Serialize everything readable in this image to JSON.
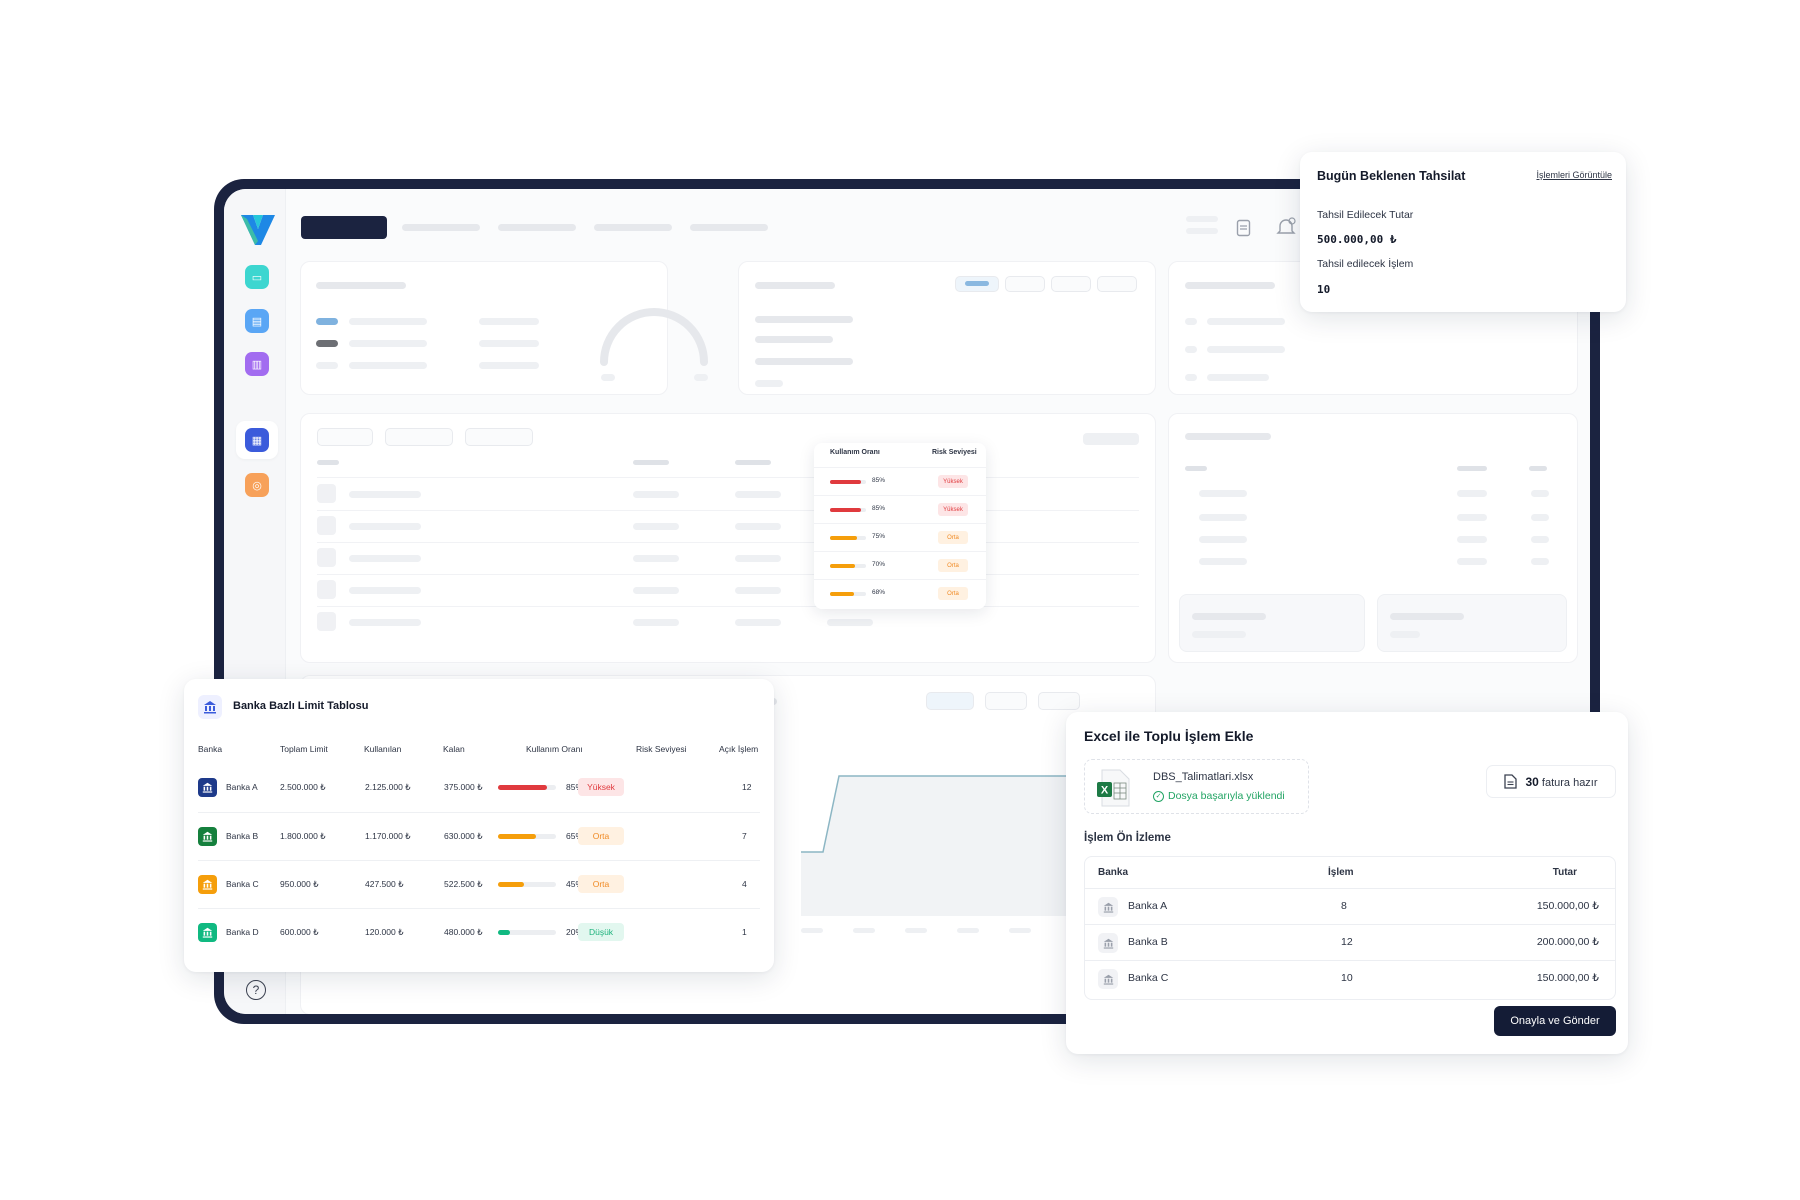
{
  "tahsilat": {
    "title": "Bugün Beklenen Tahsilat",
    "link": "İşlemleri Görüntüle",
    "amount_label": "Tahsil Edilecek Tutar",
    "amount_value": "500.000,00 ₺",
    "count_label": "Tahsil edilecek İşlem",
    "count_value": "10"
  },
  "background_popup": {
    "headers": [
      "Kullanım Oranı",
      "Risk Seviyesi"
    ],
    "rows": [
      {
        "pct": "85%",
        "ratio": 0.85,
        "risk": "Yüksek",
        "level": "high"
      },
      {
        "pct": "85%",
        "ratio": 0.85,
        "risk": "Yüksek",
        "level": "high"
      },
      {
        "pct": "75%",
        "ratio": 0.75,
        "risk": "Orta",
        "level": "mid"
      },
      {
        "pct": "70%",
        "ratio": 0.7,
        "risk": "Orta",
        "level": "mid"
      },
      {
        "pct": "68%",
        "ratio": 0.68,
        "risk": "Orta",
        "level": "mid"
      }
    ]
  },
  "limit_table": {
    "title": "Banka Bazlı Limit Tablosu",
    "headers": [
      "Banka",
      "Toplam Limit",
      "Kullanılan",
      "Kalan",
      "Kullanım Oranı",
      "Risk Seviyesi",
      "Açık İşlem"
    ],
    "rows": [
      {
        "bank": "Banka A",
        "color": "#1e3a8a",
        "total": "2.500.000 ₺",
        "used": "2.125.000 ₺",
        "remaining": "375.000 ₺",
        "pct": "85%",
        "ratio": 0.85,
        "risk": "Yüksek",
        "level": "high",
        "open": "12"
      },
      {
        "bank": "Banka B",
        "color": "#15803d",
        "total": "1.800.000 ₺",
        "used": "1.170.000 ₺",
        "remaining": "630.000 ₺",
        "pct": "65%",
        "ratio": 0.65,
        "risk": "Orta",
        "level": "mid",
        "open": "7"
      },
      {
        "bank": "Banka C",
        "color": "#f59e0b",
        "total": "950.000 ₺",
        "used": "427.500 ₺",
        "remaining": "522.500 ₺",
        "pct": "45%",
        "ratio": 0.45,
        "risk": "Orta",
        "level": "mid",
        "open": "4"
      },
      {
        "bank": "Banka D",
        "color": "#10b981",
        "total": "600.000 ₺",
        "used": "120.000 ₺",
        "remaining": "480.000 ₺",
        "pct": "20%",
        "ratio": 0.2,
        "risk": "Düşük",
        "level": "low",
        "open": "1"
      }
    ]
  },
  "excel": {
    "title": "Excel ile Toplu İşlem Ekle",
    "file_name": "DBS_Talimatlari.xlsx",
    "file_status": "Dosya başarıyla yüklendi",
    "invoice_count": "30",
    "invoice_label": "fatura hazır",
    "preview_title": "İşlem Ön İzleme",
    "headers": [
      "Banka",
      "İşlem",
      "Tutar"
    ],
    "rows": [
      {
        "bank": "Banka A",
        "count": "8",
        "amount": "150.000,00 ₺"
      },
      {
        "bank": "Banka B",
        "count": "12",
        "amount": "200.000,00 ₺"
      },
      {
        "bank": "Banka C",
        "count": "10",
        "amount": "150.000,00 ₺"
      }
    ],
    "confirm_label": "Onayla ve Gönder"
  },
  "colors": {
    "frame": "#1b2340",
    "high": "#e03a3e",
    "mid": "#f59e0b",
    "low": "#10b981",
    "primary_button": "#141c36"
  },
  "icons": [
    "logo-icon",
    "sidebar-icon-1",
    "sidebar-icon-2",
    "sidebar-icon-3",
    "sidebar-icon-4",
    "sidebar-icon-5",
    "help-icon",
    "bank-icon",
    "excel-file-icon",
    "check-circle-icon",
    "document-icon"
  ]
}
